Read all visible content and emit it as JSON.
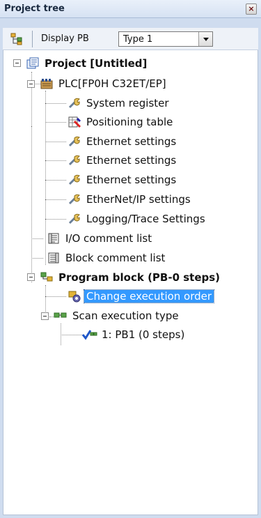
{
  "window": {
    "title": "Project tree"
  },
  "toolbar": {
    "display_label": "Display PB",
    "type_select_value": "Type 1"
  },
  "tree": {
    "project": "Project [Untitled]",
    "plc": "PLC[FP0H C32ET/EP]",
    "plc_children": [
      "System register",
      "Positioning table",
      "Ethernet settings",
      "Ethernet settings",
      "Ethernet settings",
      "EtherNet/IP settings",
      "Logging/Trace Settings"
    ],
    "io_comment": "I/O comment list",
    "block_comment": "Block comment list",
    "program_block": "Program block (PB-0 steps)",
    "change_order": "Change execution order",
    "scan_type": "Scan execution type",
    "pb1": "1: PB1 (0 steps)"
  },
  "colors": {
    "selection": "#3399ff",
    "panel_bg": "#cfdcef"
  }
}
